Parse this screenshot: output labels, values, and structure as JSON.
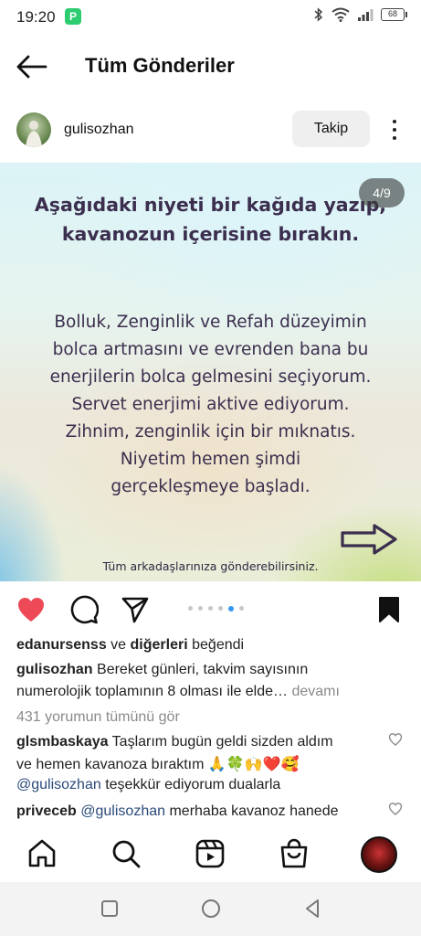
{
  "status": {
    "time": "19:20",
    "battery": "68"
  },
  "header": {
    "title": "Tüm Gönderiler"
  },
  "post": {
    "username": "gulisozhan",
    "follow_label": "Takip",
    "slide_counter": "4/9",
    "image": {
      "heading_line1": "Aşağıdaki niyeti bir kağıda yazıp,",
      "heading_line2": "kavanozun içerisine bırakın.",
      "body_lines": [
        "Bolluk, Zenginlik ve Refah düzeyimin",
        "bolca artmasını ve  evrenden bana bu",
        "enerjilerin bolca gelmesini seçiyorum.",
        "Servet enerjimi aktive ediyorum.",
        "Zihnim, zenginlik için bir mıknatıs.",
        "Niyetim hemen şimdi",
        "gerçekleşmeye başladı."
      ],
      "footer": "Tüm arkadaşlarınıza gönderebilirsiniz."
    },
    "carousel": {
      "total": 6,
      "active": 4
    },
    "likes": {
      "user": "edanursenss",
      "connector": "ve",
      "others": "diğerleri",
      "suffix": "beğendi"
    },
    "caption": {
      "username": "gulisozhan",
      "line1": "Bereket günleri, takvim sayısının",
      "line2": "numerolojik toplamının 8 olması ile elde…",
      "more": "devamı"
    },
    "view_comments": "431 yorumun tümünü gör",
    "comments": [
      {
        "username": "glsmbaskaya",
        "line1": "Taşlarım bugün geldi sizden aldım",
        "line2": "ve hemen kavanoza bıraktım 🙏🍀🙌❤️🥰",
        "mention": "@gulisozhan",
        "line3": "teşekkür ediyorum dualarla"
      },
      {
        "username": "priveceb",
        "mention": "@gulisozhan",
        "line1": "merhaba kavanoz hanede"
      }
    ]
  },
  "colors": {
    "like_red": "#ed4956",
    "link_blue": "#3897f0",
    "text_purple": "#3b2e4e"
  },
  "icons": {
    "back": "arrow-left-icon",
    "more": "more-vertical-icon",
    "like": "heart-filled-icon",
    "comment": "comment-icon",
    "share": "send-icon",
    "save": "bookmark-filled-icon",
    "home": "home-icon",
    "search": "search-icon",
    "reels": "reels-icon",
    "shop": "shop-icon"
  }
}
